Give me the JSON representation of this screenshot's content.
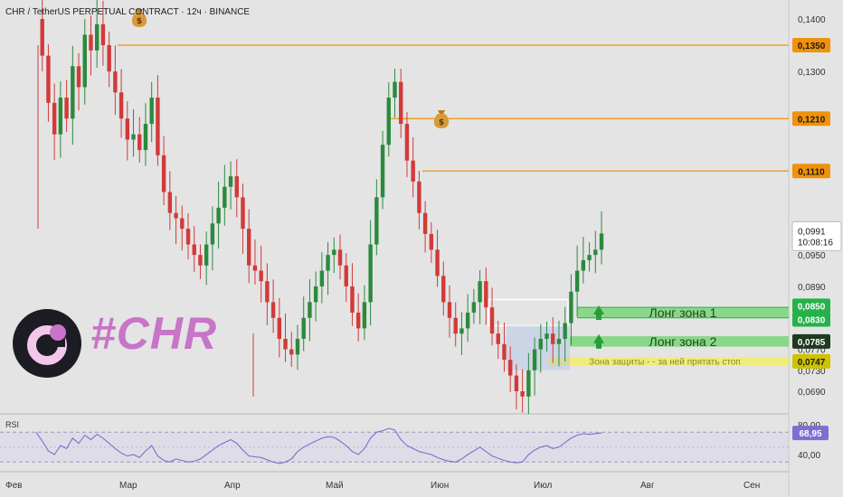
{
  "header": {
    "title": "CHR / TetherUS PERPETUAL CONTRACT · 12ч · BINANCE"
  },
  "brand": {
    "hashtag": "#CHR"
  },
  "chart_data": {
    "type": "candlestick",
    "y_axis_ticks": [
      "0,1400",
      "0,1300",
      "0,0950",
      "0,0890",
      "0,0770",
      "0,0730",
      "0,0690"
    ],
    "x_axis_ticks": [
      "Фев",
      "Мар",
      "Апр",
      "Май",
      "Июн",
      "Июл",
      "Авг",
      "Сен"
    ],
    "price_markers": [
      {
        "label": "0,1350",
        "value": 0.135,
        "color": "#f0920a",
        "text_color": "#1a1a1a"
      },
      {
        "label": "0,1210",
        "value": 0.121,
        "color": "#f0920a",
        "text_color": "#1a1a1a"
      },
      {
        "label": "0,1110",
        "value": 0.111,
        "color": "#f0920a",
        "text_color": "#1a1a1a"
      },
      {
        "label": "0,0850",
        "value": 0.085,
        "color": "#25b24a",
        "text_color": "#ffffff"
      },
      {
        "label": "0,0830",
        "value": 0.083,
        "color": "#25b24a",
        "text_color": "#ffffff"
      },
      {
        "label": "0,0785",
        "value": 0.0785,
        "color": "#1e3a1e",
        "text_color": "#ffffff"
      },
      {
        "label": "0,0747",
        "value": 0.0747,
        "color": "#cfc200",
        "text_color": "#1a1a1a"
      }
    ],
    "current_price": {
      "value": "0,0991",
      "timer": "10:08:16"
    },
    "zones": [
      {
        "label": "Лонг зона 1",
        "top": 0.085,
        "bottom": 0.083,
        "color": "#7ed67e"
      },
      {
        "label": "Лонг зона 2",
        "top": 0.0795,
        "bottom": 0.0775,
        "color": "#7ed67e"
      },
      {
        "label": "Зона защиты - - за ней прятать стоп",
        "top": 0.0755,
        "bottom": 0.074,
        "color": "#f1ec6a"
      }
    ],
    "closes": [
      0.14,
      0.133,
      0.124,
      0.118,
      0.125,
      0.121,
      0.131,
      0.127,
      0.137,
      0.134,
      0.139,
      0.135,
      0.13,
      0.126,
      0.121,
      0.117,
      0.118,
      0.115,
      0.12,
      0.125,
      0.114,
      0.107,
      0.103,
      0.102,
      0.1,
      0.097,
      0.095,
      0.093,
      0.097,
      0.101,
      0.104,
      0.108,
      0.11,
      0.106,
      0.1,
      0.093,
      0.092,
      0.09,
      0.086,
      0.083,
      0.079,
      0.077,
      0.076,
      0.079,
      0.083,
      0.086,
      0.089,
      0.092,
      0.095,
      0.096,
      0.093,
      0.089,
      0.084,
      0.081,
      0.086,
      0.097,
      0.106,
      0.116,
      0.125,
      0.128,
      0.12,
      0.113,
      0.109,
      0.103,
      0.099,
      0.096,
      0.091,
      0.086,
      0.083,
      0.08,
      0.081,
      0.084,
      0.086,
      0.09,
      0.085,
      0.08,
      0.078,
      0.075,
      0.072,
      0.069,
      0.068,
      0.073,
      0.077,
      0.079,
      0.08,
      0.078,
      0.079,
      0.082,
      0.088,
      0.092,
      0.094,
      0.095,
      0.096,
      0.0991
    ],
    "rsi": {
      "label": "RSI",
      "ticks": [
        "80,00",
        "40,00"
      ],
      "current": "68,95",
      "levels": [
        70,
        30
      ],
      "values": [
        70,
        58,
        45,
        40,
        52,
        48,
        62,
        55,
        66,
        60,
        67,
        62,
        55,
        48,
        42,
        38,
        40,
        36,
        45,
        52,
        38,
        32,
        30,
        34,
        32,
        30,
        31,
        34,
        40,
        46,
        52,
        56,
        60,
        55,
        46,
        38,
        37,
        36,
        33,
        30,
        28,
        30,
        34,
        44,
        50,
        54,
        58,
        62,
        64,
        63,
        58,
        52,
        44,
        40,
        48,
        62,
        70,
        72,
        75,
        73,
        60,
        52,
        48,
        44,
        42,
        40,
        36,
        33,
        31,
        30,
        34,
        40,
        45,
        50,
        44,
        38,
        35,
        32,
        30,
        29,
        30,
        40,
        46,
        50,
        52,
        48,
        50,
        56,
        62,
        66,
        68,
        67,
        68,
        68.95
      ]
    }
  }
}
